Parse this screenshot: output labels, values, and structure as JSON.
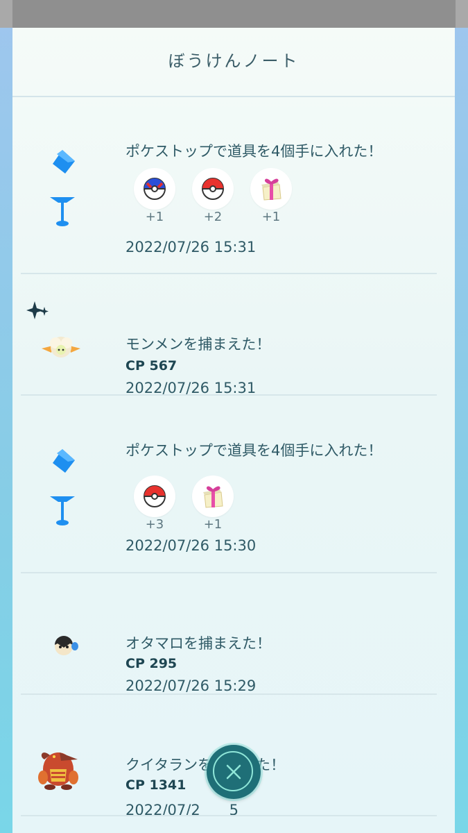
{
  "header": {
    "title": "ぼうけんノート"
  },
  "entries": [
    {
      "type": "pokestop",
      "icon": "pokestop-icon",
      "heading": "ポケストップで道具を4個手に入れた！",
      "items": [
        {
          "icon": "great-ball-icon",
          "qty": "+1"
        },
        {
          "icon": "poke-ball-icon",
          "qty": "+2"
        },
        {
          "icon": "gift-icon",
          "qty": "+1"
        }
      ],
      "timestamp": "2022/07/26 15:31"
    },
    {
      "type": "catch",
      "icon": "cottonee-icon",
      "shiny": true,
      "heading": "モンメンを捕まえた！",
      "cp": "CP 567",
      "timestamp": "2022/07/26 15:31"
    },
    {
      "type": "pokestop",
      "icon": "pokestop-icon",
      "heading": "ポケストップで道具を4個手に入れた！",
      "items": [
        {
          "icon": "poke-ball-icon",
          "qty": "+3"
        },
        {
          "icon": "gift-icon",
          "qty": "+1"
        }
      ],
      "timestamp": "2022/07/26 15:30"
    },
    {
      "type": "catch",
      "icon": "oshawott-icon",
      "heading": "オタマロを捕まえた！",
      "cp": "CP 295",
      "timestamp": "2022/07/26 15:29"
    },
    {
      "type": "catch",
      "icon": "heatmor-icon",
      "heading": "クイタランを捕まえた！",
      "cp": "CP 1341",
      "timestamp_visible": "2022/07/2　　5"
    }
  ],
  "close_button": {
    "icon": "close-icon"
  },
  "colors": {
    "accent": "#1f6f77",
    "pokestop": "#1e8ff0",
    "text": "#2f5a66"
  }
}
